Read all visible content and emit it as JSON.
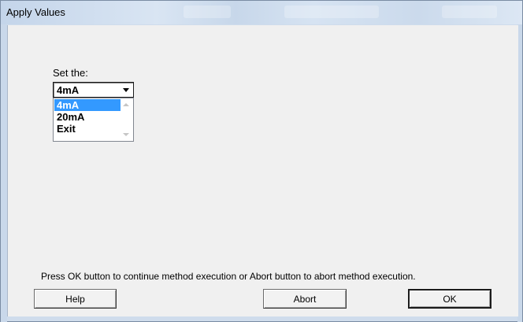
{
  "window": {
    "title": "Apply Values"
  },
  "form": {
    "label": "Set the:",
    "combo_value": "4mA",
    "options": [
      "4mA",
      "20mA",
      "Exit"
    ],
    "selected_index": 0
  },
  "message": "Press OK button to continue method execution or Abort button to abort method execution.",
  "buttons": {
    "help": "Help",
    "abort": "Abort",
    "ok": "OK"
  },
  "colors": {
    "selection": "#3399ff",
    "titlebar": "#cfdcec",
    "client": "#f0f0f0"
  }
}
